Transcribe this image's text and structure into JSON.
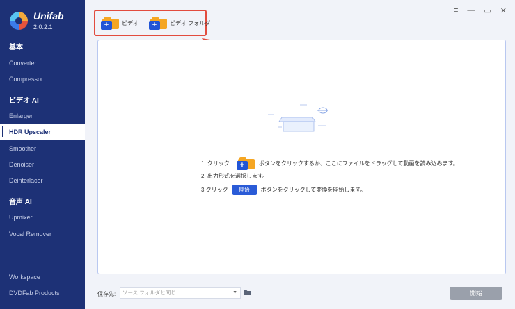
{
  "app": {
    "name": "Unifab",
    "version": "2.0.2.1"
  },
  "sidebar": {
    "sections": [
      {
        "title": "基本",
        "items": [
          "Converter",
          "Compressor"
        ]
      },
      {
        "title": "ビデオ AI",
        "items": [
          "Enlarger",
          "HDR Upscaler",
          "Smoother",
          "Denoiser",
          "Deinterlacer"
        ]
      },
      {
        "title": "音声 AI",
        "items": [
          "Upmixer",
          "Vocal Remover"
        ]
      }
    ],
    "active_item": "HDR Upscaler",
    "bottom_items": [
      "Workspace",
      "DVDFab Products"
    ]
  },
  "window_controls": [
    "menu-icon",
    "minimize-icon",
    "maximize-icon",
    "close-icon"
  ],
  "toolbar": {
    "video_label": "ビデオ",
    "video_folder_label": "ビデオ フォルダ"
  },
  "instructions": {
    "step1_prefix": "1. クリック",
    "step1_suffix": "ボタンをクリックするか、ここにファイルをドラッグして動画を読み込みます。",
    "step2": "2. 出力形式を選択します。",
    "step3_prefix": "3.クリック",
    "step3_button": "開始",
    "step3_suffix": "ボタンをクリックして変換を開始します。"
  },
  "footer": {
    "save_label": "保存先:",
    "save_placeholder": "ソース フォルダと同じ",
    "start_label": "開始"
  },
  "colors": {
    "sidebar": "#1d3176",
    "accent": "#2a5bd7",
    "highlight_box": "#e24c3f",
    "folder": "#f5a623"
  }
}
